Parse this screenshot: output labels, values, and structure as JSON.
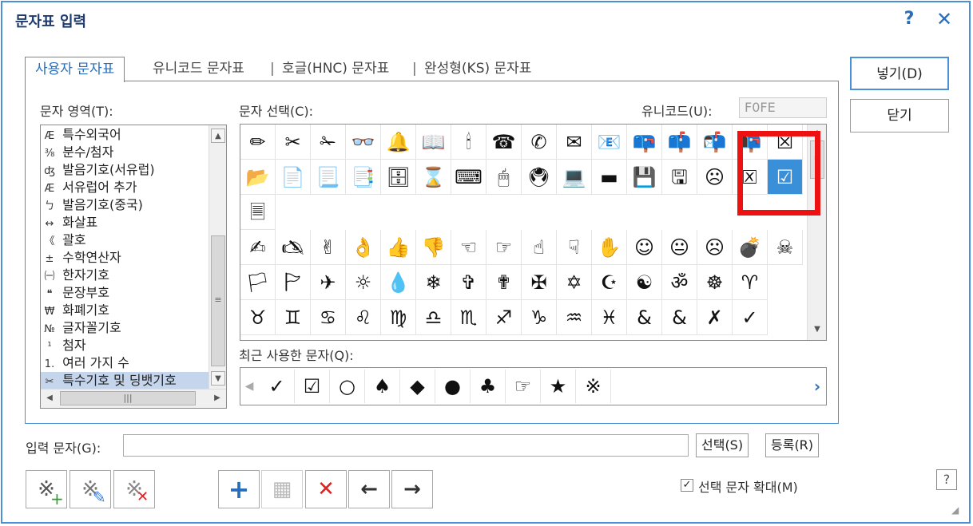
{
  "dialog": {
    "title": "문자표 입력",
    "help_label": "?",
    "close_label": "✕"
  },
  "tabs": [
    {
      "label": "사용자 문자표"
    },
    {
      "label": "유니코드 문자표"
    },
    {
      "label": "호글(HNC) 문자표"
    },
    {
      "label": "완성형(KS) 문자표"
    }
  ],
  "tab_separator": "|",
  "area": {
    "label": "문자 영역(T):",
    "items": [
      {
        "icon": "Æ",
        "label": "특수외국어"
      },
      {
        "icon": "⅜",
        "label": "분수/첨자"
      },
      {
        "icon": "ʤ",
        "label": "발음기호(서유럽)"
      },
      {
        "icon": "Æ",
        "label": "서유럽어 추가"
      },
      {
        "icon": "ㄅ",
        "label": "발음기호(중국)"
      },
      {
        "icon": "↔",
        "label": "화살표"
      },
      {
        "icon": "《",
        "label": "괄호"
      },
      {
        "icon": "±",
        "label": "수학연산자"
      },
      {
        "icon": "㈠",
        "label": "한자기호"
      },
      {
        "icon": "❝",
        "label": "문장부호"
      },
      {
        "icon": "₩",
        "label": "화폐기호"
      },
      {
        "icon": "№",
        "label": "글자꼴기호"
      },
      {
        "icon": "¹",
        "label": "첨자"
      },
      {
        "icon": "1.",
        "label": "여러 가지 수"
      },
      {
        "icon": "✂",
        "label": "특수기호 및 딩뱃기호"
      }
    ],
    "selected_index": 14,
    "hscroll_thumb": "|||",
    "vscroll_thumb": "≡"
  },
  "char_select": {
    "label": "문자 선택(C):",
    "unicode_label": "유니코드(U):",
    "unicode_value": "F0FE",
    "rows": [
      [
        "✏",
        "✂",
        "✁",
        "👓",
        "🔔",
        "📖",
        "🕯",
        "☎",
        "✆",
        "✉",
        "📧",
        "📪",
        "📫",
        "📬",
        "📭"
      ],
      [
        "📂",
        "📄",
        "📃",
        "📑",
        "🗄",
        "⌛",
        "⌨",
        "🖱",
        "🖲",
        "💻",
        "▬",
        "💾",
        "🖫",
        "☹",
        "🗵"
      ],
      [
        "🗏"
      ],
      [
        "✍",
        "🖎",
        "✌",
        "👌",
        "👍",
        "👎",
        "☜",
        "☞",
        "☝",
        "☟",
        "✋",
        "☺",
        "😐",
        "☹",
        "💣"
      ],
      [
        "🏳",
        "🏱",
        "✈",
        "☼",
        "💧",
        "❄",
        "✞",
        "✟",
        "✠",
        "✡",
        "☪",
        "☯",
        "ॐ",
        "☸",
        "♈"
      ],
      [
        "♉",
        "♊",
        "♋",
        "♌",
        "♍",
        "♎",
        "♏",
        "♐",
        "♑",
        "♒",
        "♓",
        "&",
        "&",
        "✗",
        "✓"
      ]
    ],
    "selected_symbol": "☑",
    "extra_row1_last": "☠",
    "row1_partial": "☒",
    "scroll_thumb": "≡"
  },
  "recent": {
    "label": "최근 사용한 문자(Q):",
    "chars": [
      "✓",
      "☑",
      "○",
      "♠",
      "◆",
      "●",
      "♣",
      "☞",
      "★",
      "※"
    ]
  },
  "buttons": {
    "insert": "넣기(D)",
    "close": "닫기",
    "select": "선택(S)",
    "register": "등록(R)"
  },
  "input": {
    "label": "입력 문자(G):",
    "value": ""
  },
  "toolbar": {
    "add_icon": "※",
    "edit_icon": "※",
    "delete_icon": "※",
    "plus": "+",
    "grid_add": "▦",
    "x": "✕",
    "left": "←",
    "right": "→"
  },
  "options": {
    "enlarge_label": "선택 문자 확대(M)",
    "enlarge_checked": "✓"
  },
  "colors": {
    "accent": "#4a90d9",
    "highlight": "#ee1111",
    "selected_cell": "#3a8fd9"
  }
}
